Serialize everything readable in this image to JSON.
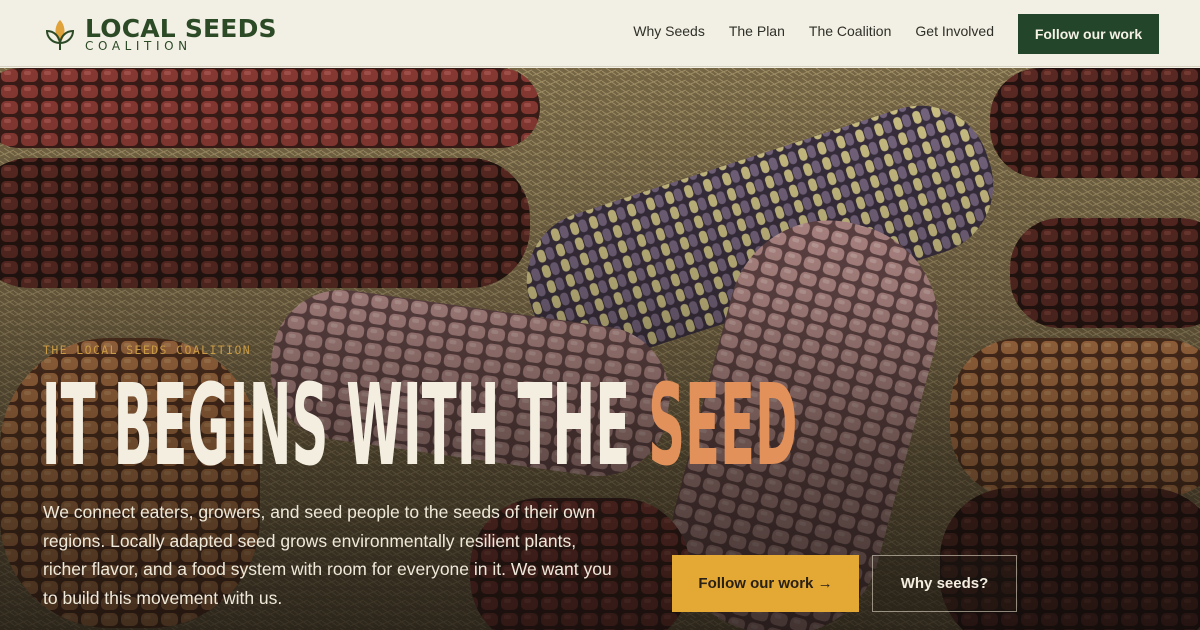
{
  "brand": {
    "title": "LOCAL SEEDS",
    "subtitle": "COALITION",
    "logo_icon": "seed-leaf-icon",
    "primary_color": "#23452a"
  },
  "nav": {
    "items": [
      {
        "label": "Why Seeds"
      },
      {
        "label": "The Plan"
      },
      {
        "label": "The Coalition"
      },
      {
        "label": "Get Involved"
      }
    ],
    "cta_label": "Follow our work"
  },
  "hero": {
    "eyebrow": "THE LOCAL SEEDS COALITION",
    "headline_main": "IT BEGINS WITH THE ",
    "headline_accent": "SEED",
    "headline_accent_color": "#e3915a",
    "body": "We connect eaters, growers, and seed people to the seeds of their own regions. Locally adapted seed grows environmentally resilient plants, richer flavor, and a food system with room for everyone in it. We want you to build this movement with us.",
    "primary_button": "Follow our work →",
    "secondary_button": "Why seeds?",
    "button_accent_color": "#e4a935"
  }
}
